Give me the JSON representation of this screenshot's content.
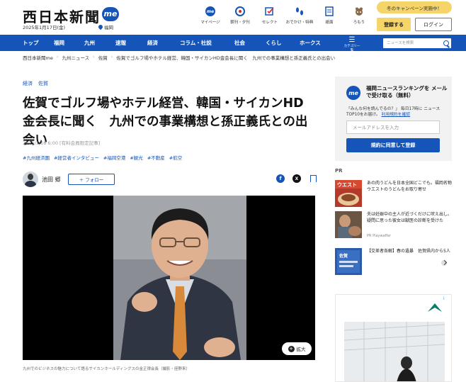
{
  "header": {
    "logo_text": "西日本新聞",
    "logo_badge": "me",
    "date": "2025年1月17日(金)",
    "region": "福岡",
    "icons": [
      {
        "label": "マイページ",
        "icon": "me-icon"
      },
      {
        "label": "朝刊・夕刊",
        "icon": "newspaper-icon"
      },
      {
        "label": "セレクト",
        "icon": "select-icon"
      },
      {
        "label": "おでかけ・特典",
        "icon": "footprints-icon"
      },
      {
        "label": "紙面",
        "icon": "paper-icon"
      },
      {
        "label": "ろもり",
        "icon": "raccoon-icon"
      }
    ],
    "campaign": "冬のキャンペーン実施中！",
    "register_label": "登録する",
    "login_label": "ログイン"
  },
  "nav": {
    "items": [
      "トップ",
      "福岡",
      "九州",
      "速報",
      "経済",
      "コラム・社説",
      "社会",
      "くらし",
      "ホークス"
    ],
    "menu_label": "カテゴリ一覧",
    "search_placeholder": "ニュースを検索"
  },
  "breadcrumb": [
    "西日本新聞me",
    "九州ニュース",
    "佐賀",
    "佐賀でゴルフ場やホテル経営、韓国・サイカンHD金会長に聞く　九州での事業構想と孫正義氏との出会い"
  ],
  "article": {
    "categories": [
      "経済",
      "佐賀"
    ],
    "title": "佐賀でゴルフ場やホテル経営、韓国・サイカンHD金会長に聞く　九州での事業構想と孫正義氏との出会い",
    "meta": "2025/1/16 6:00 [有料会員限定記事]",
    "hashtags": [
      "#九州経済圏",
      "#経営者インタビュー",
      "#福岡空港",
      "#観光",
      "#不動産",
      "#航空"
    ],
    "author": "池田 郷",
    "follow_label": "＋ フォロー",
    "share_fb": "f",
    "share_x": "X",
    "zoom_label": "拡大",
    "caption": "九州でのビジネスの魅力について語るサイカンホールディングスの金正律会長（撮影・座野来）"
  },
  "sidebar": {
    "ranking": {
      "icon_text": "me",
      "title": "福岡ニュースランキングを メールで受け取る（無料）",
      "desc": "「みんな何を読んでるの？」 毎日17時に ニュースTOP10をお届け。",
      "link": "利用規約を確認",
      "email_placeholder": "メールアドレスを入力",
      "submit_label": "規約に同意して登録"
    },
    "pr_label": "PR",
    "pr_items": [
      {
        "text": "あの肉うどんを日本全国どこでも。福岡名物ウエストのうどんをお取り寄せ",
        "source": ""
      },
      {
        "text": "夫は妊娠中の主人が近づくだけに吠え出し。疑問に思った彼女は獣医の診断を受けた",
        "source": "PR Playwaffer"
      },
      {
        "text": "【交差者各解】春の遺暴　佐賀県内から5人",
        "source": ""
      }
    ],
    "ad_info": "i"
  },
  "colors": {
    "brand": "#1554b8",
    "accent": "#f5d46a"
  }
}
